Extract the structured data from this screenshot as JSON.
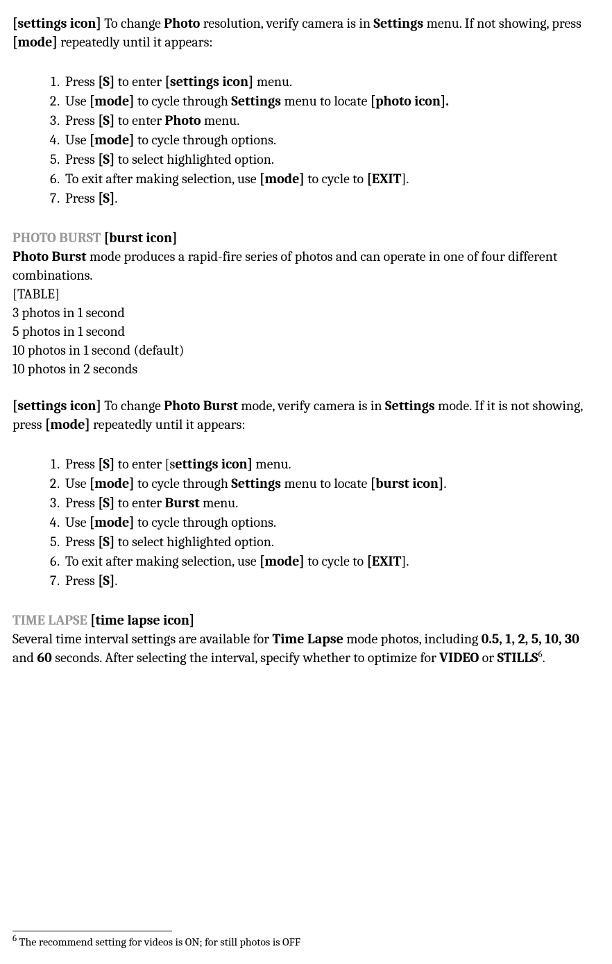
{
  "section1": {
    "intro_prefix": "[settings icon]",
    "intro_1": " To change ",
    "intro_bold1": "Photo",
    "intro_2": " resolution, verify camera is in ",
    "intro_bold2": "Settings",
    "intro_3": " menu. If not showing, press ",
    "intro_bold3": "[mode]",
    "intro_4": " repeatedly until it appears:",
    "steps": {
      "s1_1": "Press ",
      "s1_b1": "[S]",
      "s1_2": " to enter ",
      "s1_b2": "[settings icon]",
      "s1_3": " menu.",
      "s2_1": "Use ",
      "s2_b1": "[mode]",
      "s2_2": " to cycle through ",
      "s2_b2": "Settings",
      "s2_3": " menu to locate ",
      "s2_b3": "[photo icon].",
      "s3_1": "Press ",
      "s3_b1": "[S]",
      "s3_2": " to enter ",
      "s3_b2": "Photo",
      "s3_3": " menu.",
      "s4_1": "Use ",
      "s4_b1": "[mode]",
      "s4_2": " to cycle through options.",
      "s5_1": "Press ",
      "s5_b1": "[S]",
      "s5_2": " to select highlighted option.",
      "s6_1": "To exit after making selection, use ",
      "s6_b1": "[mode]",
      "s6_2": " to cycle to ",
      "s6_b2": "[EXIT",
      "s6_3": "].",
      "s7_1": "Press ",
      "s7_b1": "[S]",
      "s7_2": "."
    }
  },
  "section2": {
    "heading_grey": "PHOTO BURST",
    "heading_icon": " [burst icon]",
    "intro_b1": "Photo Burst",
    "intro_1": " mode produces a rapid-fire series of photos and can operate in one of four different combinations.",
    "table_label": "[TABLE]",
    "table_rows": [
      "3 photos in 1 second",
      "5 photos in 1 second",
      "10 photos in 1 second  (default)",
      "10 photos in 2 seconds"
    ]
  },
  "section3": {
    "intro_prefix": "[settings icon]",
    "intro_1": " To change ",
    "intro_bold1": "Photo Burst",
    "intro_2": " mode, verify camera is in ",
    "intro_bold2": "Settings",
    "intro_3": " mode. If it is not showing, press ",
    "intro_bold3": "[mode]",
    "intro_4": " repeatedly until it appears:",
    "steps": {
      "s1_1": "Press ",
      "s1_b1": "[S]",
      "s1_2": " to enter [s",
      "s1_b2": "ettings icon]",
      "s1_3": " menu.",
      "s2_1": "Use ",
      "s2_b1": "[mode]",
      "s2_2": " to cycle through ",
      "s2_b2": "Settings",
      "s2_3": " menu to locate ",
      "s2_b3": "[burst icon]",
      "s2_4": ".",
      "s3_1": "Press ",
      "s3_b1": "[S]",
      "s3_2": " to enter ",
      "s3_b2": "Burst",
      "s3_3": " menu.",
      "s4_1": "Use ",
      "s4_b1": "[mode]",
      "s4_2": " to cycle through options.",
      "s5_1": "Press ",
      "s5_b1": "[S]",
      "s5_2": " to select highlighted option.",
      "s6_1": "To exit after making selection, use ",
      "s6_b1": "[mode]",
      "s6_2": " to cycle to ",
      "s6_b2": "[EXIT",
      "s6_3": "].",
      "s7_1": "Press ",
      "s7_b1": "[S]",
      "s7_2": "."
    }
  },
  "section4": {
    "heading_grey": "TIME LAPSE",
    "heading_icon": " [time lapse icon]",
    "intro_1": "Several time interval settings are available for ",
    "intro_b1": "Time Lapse",
    "intro_2": " mode photos, including ",
    "intro_b2": "0.5, 1, 2, 5, 10, 30",
    "intro_3": " and ",
    "intro_b3": "60",
    "intro_4": " seconds. After selecting the interval, specify whether to optimize for ",
    "intro_b4": "VIDEO",
    "intro_5": " or ",
    "intro_b5": "STILLS",
    "intro_sup": "6",
    "intro_6": "."
  },
  "footnote": {
    "marker": "6",
    "text": " The recommend setting for videos  is ON; for still photos is OFF"
  }
}
